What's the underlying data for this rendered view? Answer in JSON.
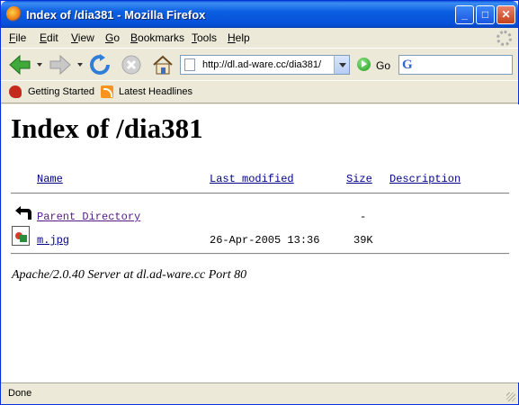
{
  "window": {
    "title": "Index of /dia381 - Mozilla Firefox"
  },
  "menu": [
    "File",
    "Edit",
    "View",
    "Go",
    "Bookmarks",
    "Tools",
    "Help"
  ],
  "menu_access_keys": [
    "F",
    "E",
    "V",
    "G",
    "B",
    "T",
    "H"
  ],
  "toolbar": {
    "url": "http://dl.ad-ware.cc/dia381/",
    "go_label": "Go",
    "search_placeholder": "",
    "icons": [
      "back-icon",
      "forward-icon",
      "reload-icon",
      "stop-icon",
      "home-icon",
      "go-icon",
      "google-search-icon"
    ]
  },
  "bookmarks": [
    {
      "label": "Getting Started",
      "icon": "firefox-bookmark-icon"
    },
    {
      "label": "Latest Headlines",
      "icon": "rss-feed-icon"
    }
  ],
  "page": {
    "heading": "Index of /dia381",
    "columns": {
      "name": "Name",
      "last_modified": "Last modified",
      "size": "Size",
      "description": "Description"
    },
    "rows": [
      {
        "icon": "parent-directory-icon",
        "name": "Parent Directory",
        "last_modified": "",
        "size": "-",
        "description": ""
      },
      {
        "icon": "image-file-icon",
        "name": "m.jpg",
        "last_modified": "26-Apr-2005 13:36",
        "size": "39K",
        "description": ""
      }
    ],
    "address": "Apache/2.0.40 Server at dl.ad-ware.cc Port 80"
  },
  "status": {
    "text": "Done"
  },
  "colors": {
    "titlebar": "#0550d8",
    "link": "#00008b",
    "visited_link": "#551a8b",
    "chrome": "#ece9d8"
  }
}
